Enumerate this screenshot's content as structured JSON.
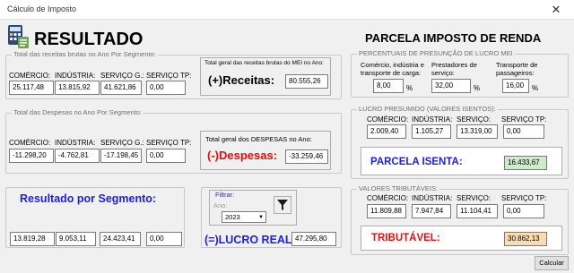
{
  "window": {
    "title": "Cálculo de Imposto",
    "close_glyph": "✕"
  },
  "header": {
    "title": "RESULTADO",
    "icon": "calculator-icon"
  },
  "receitas": {
    "group_label": "Total das receitas brutas no Ano Por Segmento:",
    "labels": [
      "COMÉRCIO:",
      "INDÚSTRIA:",
      "SERVIÇO G.:",
      "SERVIÇO TP:"
    ],
    "values": [
      "25.117,48",
      "13.815,92",
      "41.621,86",
      "0,00"
    ],
    "total_caption": "Total geral das receitas brutas do MEI no Ano:",
    "total_label": "(+)Receitas:",
    "total_value": "80.555,26"
  },
  "despesas": {
    "group_label": "Total das Despesas no Ano Por Segmento:",
    "labels": [
      "COMÉRCIO:",
      "INDÚSTRIA:",
      "SERVIÇO G.:",
      "SERVIÇO TP:"
    ],
    "values": [
      "-11.298,20",
      "-4.762,81",
      "-17.198,45",
      "0,00"
    ],
    "total_caption": "Total geral dos DESPESAS no Ano:",
    "total_label": "(-)Despesas:",
    "total_value": "-33.259,46"
  },
  "resultado": {
    "title": "Resultado por Segmento:",
    "values": [
      "13.819,28",
      "9.053,11",
      "24.423,41",
      "0,00"
    ]
  },
  "filtro": {
    "group_label": "Filtrar:",
    "ano_label": "Ano:",
    "ano_value": "2023",
    "filter_icon": "funnel-icon",
    "lucro_label": "(=)LUCRO REAL:",
    "lucro_value": "47.295,80"
  },
  "parcela": {
    "title": "PARCELA IMPOSTO DE RENDA",
    "percentuais_label": "PERCENTUAIS DE PRESUNÇÃO DE LUCRO MEI",
    "percent_labels": [
      "Comércio, indústria e transporte de carga:",
      "Prestadores de serviço:",
      "Transporte de passageiros:"
    ],
    "percent_values": [
      "8,00",
      "32,00",
      "16,00"
    ],
    "percent_sign": "%"
  },
  "lucro_presumido": {
    "group_label": "LUCRO PRESUMIDO (VALORES ISENTOS):",
    "labels": [
      "COMÉRCIO:",
      "INDÚSTRIA:",
      "SERVIÇO:",
      "SERVIÇO TP:"
    ],
    "values": [
      "2.009,40",
      "1.105,27",
      "13.319,00",
      "0,00"
    ],
    "isenta_label": "PARCELA ISENTA:",
    "isenta_value": "16.433,67"
  },
  "tributaveis": {
    "group_label": "VALORES TRIBUTÁVEIS:",
    "labels": [
      "COMÉRCIO:",
      "INDÚSTRIA:",
      "SERVIÇO:",
      "SERVIÇO TP:"
    ],
    "values": [
      "11.809,88",
      "7.947,84",
      "11.104,41",
      "0,00"
    ],
    "tributavel_label": "TRIBUTÁVEL:",
    "tributavel_value": "30.862,13"
  },
  "calcular_button": "Calcular",
  "colors": {
    "blue": "#1f1fdc",
    "red": "#e01010",
    "green_fill": "#cdebc8",
    "orange_fill": "#fbdcb2"
  }
}
